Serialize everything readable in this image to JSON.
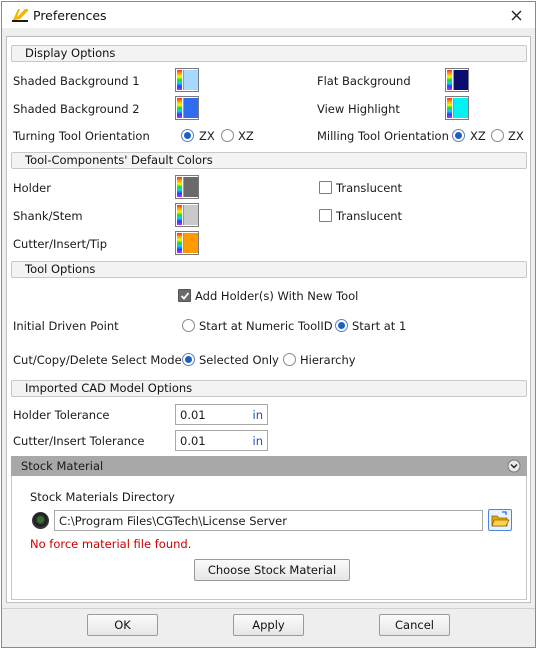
{
  "window": {
    "title": "Preferences"
  },
  "display": {
    "header": "Display Options",
    "shaded_bg_1": {
      "label": "Shaded Background 1",
      "color": "#a9d8ff"
    },
    "shaded_bg_2": {
      "label": "Shaded Background 2",
      "color": "#2f6cf0"
    },
    "flat_bg": {
      "label": "Flat Background",
      "color": "#0b0c6e"
    },
    "view_highlight": {
      "label": "View Highlight",
      "color": "#00f2f2"
    },
    "turning": {
      "label": "Turning Tool Orientation",
      "options": [
        "ZX",
        "XZ"
      ],
      "selected": "ZX"
    },
    "milling": {
      "label": "Milling Tool Orientation",
      "options": [
        "XZ",
        "ZX"
      ],
      "selected": "XZ"
    }
  },
  "components": {
    "header": "Tool-Components' Default Colors",
    "holder": {
      "label": "Holder",
      "color": "#6a6a6a",
      "translucent_label": "Translucent",
      "translucent": false
    },
    "shank": {
      "label": "Shank/Stem",
      "color": "#c9c9c9",
      "translucent_label": "Translucent",
      "translucent": false
    },
    "cutter": {
      "label": "Cutter/Insert/Tip",
      "color": "#ff9a00"
    }
  },
  "tool_options": {
    "header": "Tool Options",
    "add_holder": {
      "label": "Add Holder(s) With New Tool",
      "checked": true
    },
    "driven_point": {
      "label": "Initial Driven Point",
      "options": [
        "Start at Numeric ToolID",
        "Start at 1"
      ],
      "selected": "Start at 1"
    },
    "select_mode": {
      "label": "Cut/Copy/Delete Select Mode",
      "options": [
        "Selected Only",
        "Hierarchy"
      ],
      "selected": "Selected Only"
    }
  },
  "cad": {
    "header": "Imported CAD Model Options",
    "holder_tol": {
      "label": "Holder Tolerance",
      "value": "0.01",
      "unit": "in"
    },
    "cutter_tol": {
      "label": "Cutter/Insert Tolerance",
      "value": "0.01",
      "unit": "in"
    }
  },
  "stock": {
    "header": "Stock Material",
    "dir_label": "Stock Materials Directory",
    "dir_value": "C:\\Program Files\\CGTech\\License Server",
    "error": "No force material file found.",
    "choose_button": "Choose Stock Material"
  },
  "buttons": {
    "ok": "OK",
    "apply": "Apply",
    "cancel": "Cancel"
  },
  "icons": {
    "app": "vericut-logo-icon",
    "close": "close-icon",
    "chevron": "chevron-down-icon",
    "folder": "open-folder-icon",
    "status": "status-indicator-icon"
  }
}
